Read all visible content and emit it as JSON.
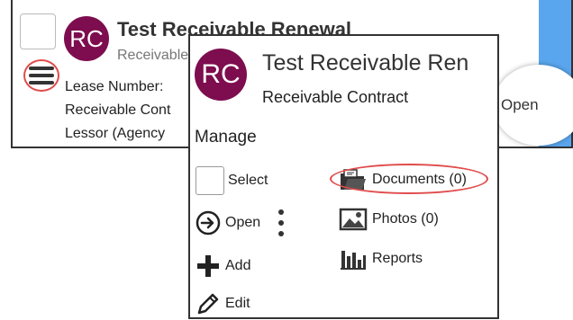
{
  "background_card": {
    "avatar_initials": "RC",
    "title": "Test Receivable Renewal",
    "subtitle": "Receivable",
    "fields": [
      "Lease Number:",
      "Receivable Cont",
      "Lessor (Agency"
    ],
    "open_label": "Open"
  },
  "popup": {
    "avatar_initials": "RC",
    "title": "Test Receivable Ren",
    "subtitle": "Receivable Contract",
    "section_label": "Manage",
    "actions": {
      "select": "Select",
      "open": "Open",
      "add": "Add",
      "edit": "Edit",
      "documents": "Documents (0)",
      "photos": "Photos (0)",
      "reports": "Reports"
    }
  },
  "colors": {
    "avatar": "#7d0d4e",
    "highlight_ring": "#e14b4b",
    "accent_blue": "#5aa6ee"
  },
  "icons": [
    "hamburger-icon",
    "arrow-circle-icon",
    "plus-icon",
    "pencil-icon",
    "folder-icon",
    "photo-icon",
    "reports-icon",
    "kebab-icon"
  ]
}
